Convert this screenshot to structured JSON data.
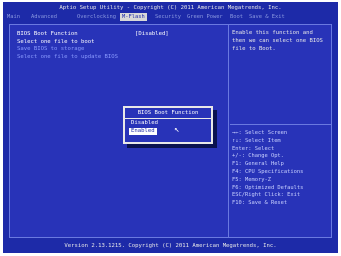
{
  "header": {
    "title": "Aptio Setup Utility - Copyright (C) 2011 American Megatrends, Inc."
  },
  "tabs": [
    {
      "label": "Main"
    },
    {
      "label": "Advanced"
    },
    {
      "label": "Overclocking"
    },
    {
      "label": "M-Flash"
    },
    {
      "label": "Security"
    },
    {
      "label": "Green Power"
    },
    {
      "label": "Boot"
    },
    {
      "label": "Save & Exit"
    }
  ],
  "settings": {
    "bios_boot_label": "BIOS Boot Function",
    "bios_boot_value": "[Disabled]",
    "select_file_boot": "Select one file to boot",
    "save_bios": "Save BIOS to storage",
    "select_file_update": "Select one file to update BIOS"
  },
  "help_text": "Enable this function and then we can select one BIOS file to Boot.",
  "keys": [
    "→←: Select Screen",
    "↑↓: Select Item",
    "Enter: Select",
    "+/-: Change Opt.",
    "F1: General Help",
    "F4: CPU Specifications",
    "F5: Memory-Z",
    "F6: Optimized Defaults",
    "ESC/Right Click: Exit",
    "F10: Save & Reset"
  ],
  "popup": {
    "title": "BIOS Boot Function",
    "options": [
      "Disabled",
      "Enabled"
    ],
    "selected": "Enabled"
  },
  "footer": {
    "version": "Version 2.13.1215. Copyright (C) 2011 American Megatrends, Inc."
  },
  "colors": {
    "background": "#1d2aa8",
    "active_tab": "#d8d8d8"
  }
}
